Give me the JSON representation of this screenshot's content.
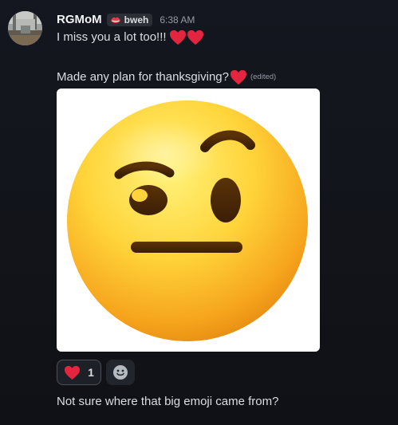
{
  "message": {
    "username": "RGMoM",
    "tag": "bweh",
    "tag_icon": "lips-icon",
    "timestamp": "6:38 AM",
    "lines": [
      "I miss you a lot too!!!",
      "Made any plan for thanksgiving?"
    ],
    "edited_label": "(edited)",
    "image": "face-with-raised-eyebrow-emoji"
  },
  "reactions": [
    {
      "emoji": "red-heart",
      "count": "1"
    }
  ],
  "add_reaction_icon": "smiley-icon",
  "followup_message": "Not sure where that big emoji came from?",
  "colors": {
    "background": "#13151b",
    "username": "#f2f3f5",
    "text": "#dbdee1",
    "muted": "#949ba4",
    "heart": "#e3253f",
    "tag_bg": "#2c2f36"
  }
}
